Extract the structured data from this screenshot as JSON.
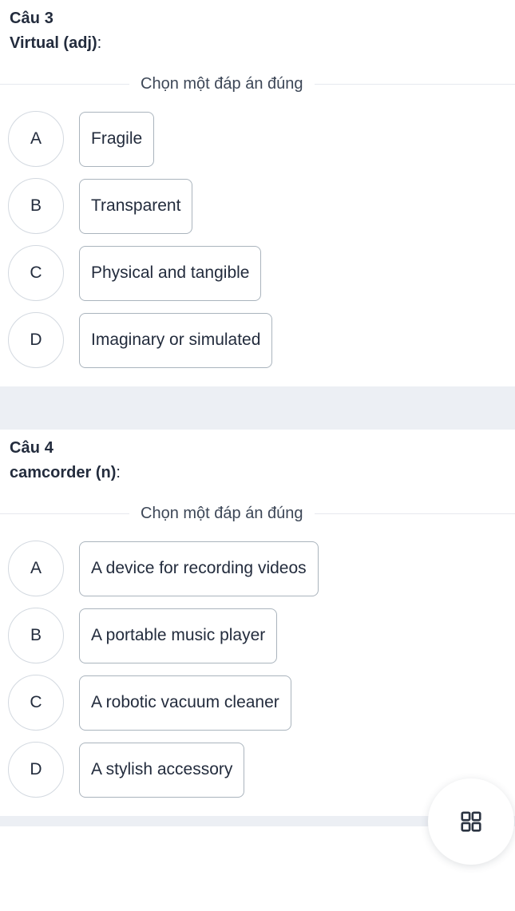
{
  "questions": [
    {
      "number_label": "Câu 3",
      "prompt_term": "Virtual (adj)",
      "prompt_colon": ":",
      "choose_caption": "Chọn một đáp án đúng",
      "options": [
        {
          "letter": "A",
          "text": "Fragile"
        },
        {
          "letter": "B",
          "text": "Transparent"
        },
        {
          "letter": "C",
          "text": "Physical and tangible"
        },
        {
          "letter": "D",
          "text": "Imaginary or simulated"
        }
      ]
    },
    {
      "number_label": "Câu 4",
      "prompt_term": "camcorder (n)",
      "prompt_colon": ":",
      "choose_caption": "Chọn một đáp án đúng",
      "options": [
        {
          "letter": "A",
          "text": "A device for recording videos"
        },
        {
          "letter": "B",
          "text": "A portable music player"
        },
        {
          "letter": "C",
          "text": "A robotic vacuum cleaner"
        },
        {
          "letter": "D",
          "text": "A stylish accessory"
        }
      ]
    }
  ],
  "fab": {
    "icon": "grid-2x2-icon"
  },
  "colors": {
    "text": "#232c3d",
    "band": "#eceff4",
    "rule": "#e6e9ee",
    "option_border": "#aab4bd",
    "circle_border": "#d3d9e0"
  }
}
